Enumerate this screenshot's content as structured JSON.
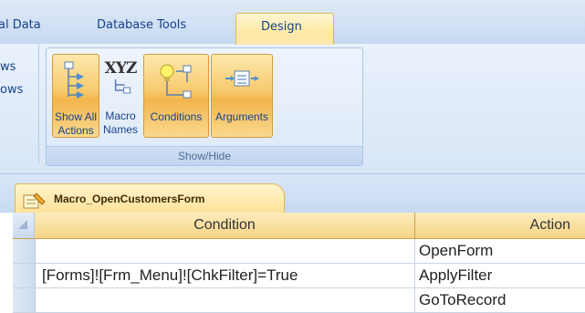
{
  "ribbon_tabs": {
    "external_data": "al Data",
    "database_tools": "Database Tools",
    "design": "Design"
  },
  "left_group": {
    "line1": "ws",
    "line2": "ows"
  },
  "show_hide_group": {
    "label": "Show/Hide",
    "show_all_actions": {
      "line1": "Show All",
      "line2": "Actions",
      "icon": "tree-actions-icon",
      "active": true
    },
    "macro_names": {
      "line1": "Macro",
      "line2": "Names",
      "icon_text": "XYZ",
      "active": false
    },
    "conditions": {
      "line1": "Conditions",
      "icon": "conditions-icon",
      "active": true
    },
    "arguments": {
      "line1": "Arguments",
      "icon": "arguments-icon",
      "active": true
    }
  },
  "document_tab": {
    "title": "Macro_OpenCustomersForm",
    "icon": "macro-icon"
  },
  "grid": {
    "columns": {
      "condition": "Condition",
      "action": "Action"
    },
    "rows": [
      {
        "condition": "",
        "action": "OpenForm"
      },
      {
        "condition": "[Forms]![Frm_Menu]![ChkFilter]=True",
        "action": "ApplyFilter"
      },
      {
        "condition": "",
        "action": "GoToRecord"
      }
    ]
  },
  "colors": {
    "accent_active": "#f7c96c",
    "ribbon_text": "#15428b",
    "tab_highlight": "#ffe9a6"
  }
}
